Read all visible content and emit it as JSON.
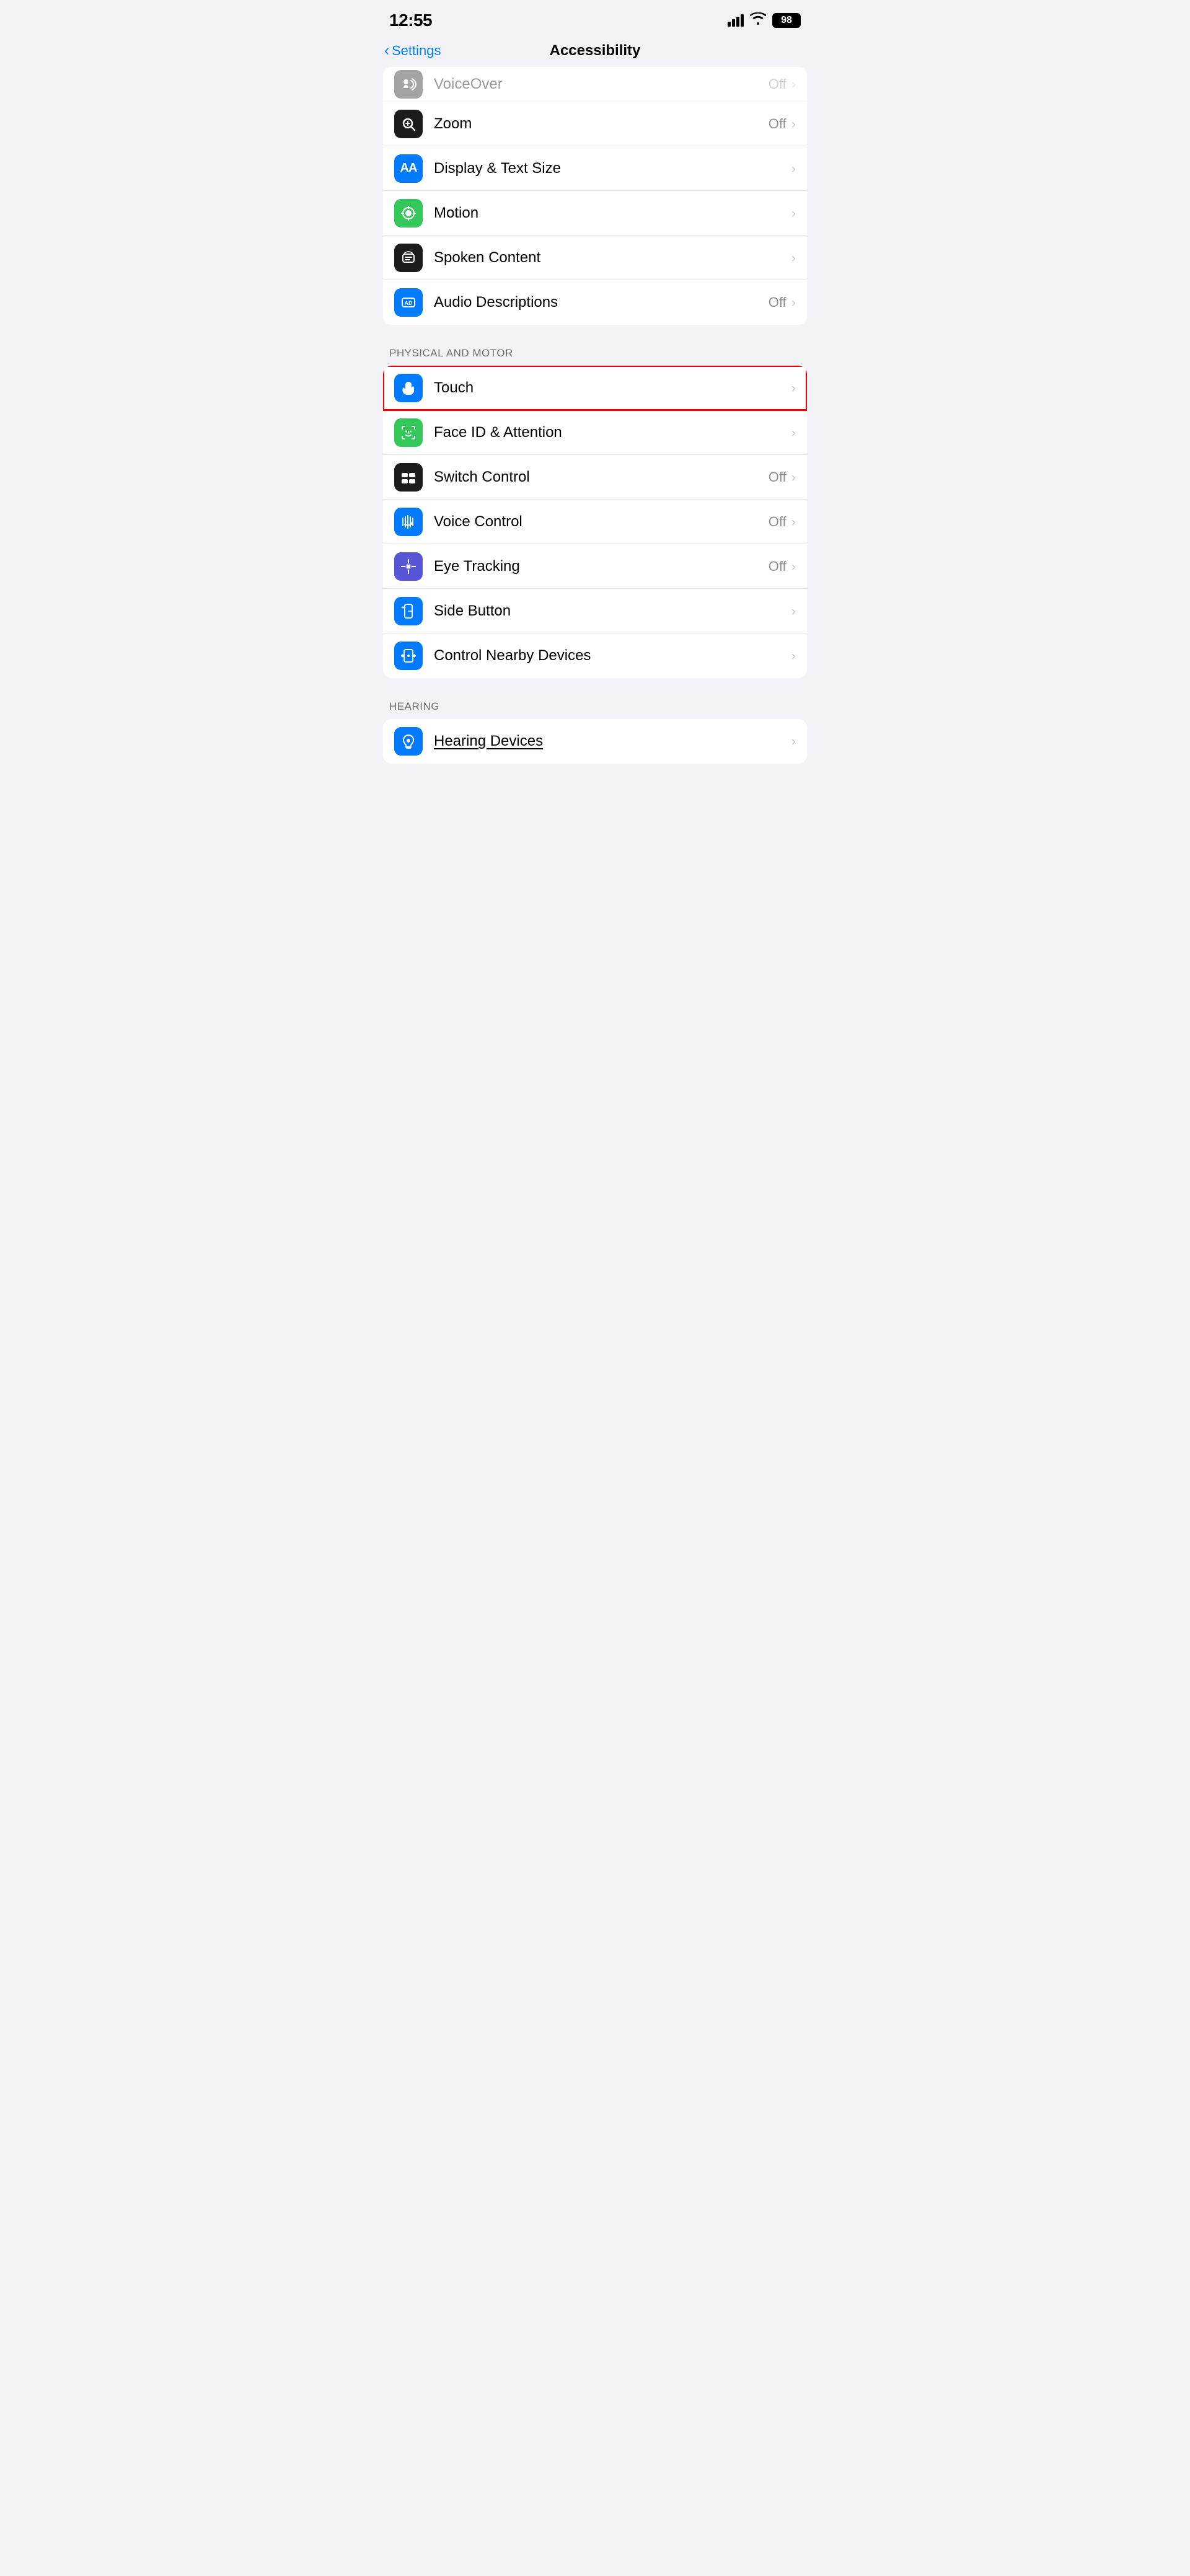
{
  "statusBar": {
    "time": "12:55",
    "battery": "98"
  },
  "navBar": {
    "backLabel": "Settings",
    "title": "Accessibility"
  },
  "visionSection": {
    "items": [
      {
        "id": "voiceover",
        "icon": "voiceover",
        "iconBg": "icon-black",
        "label": "VoiceOver",
        "value": "Off",
        "hasValue": true
      },
      {
        "id": "zoom",
        "icon": "zoom",
        "iconBg": "icon-black",
        "label": "Zoom",
        "value": "Off",
        "hasValue": true
      },
      {
        "id": "display-text-size",
        "icon": "aa",
        "iconBg": "icon-blue",
        "label": "Display & Text Size",
        "value": "",
        "hasValue": false
      },
      {
        "id": "motion",
        "icon": "motion",
        "iconBg": "icon-green",
        "label": "Motion",
        "value": "",
        "hasValue": false
      },
      {
        "id": "spoken-content",
        "icon": "spoken",
        "iconBg": "icon-black",
        "label": "Spoken Content",
        "value": "",
        "hasValue": false
      },
      {
        "id": "audio-descriptions",
        "icon": "audio-desc",
        "iconBg": "icon-blue",
        "label": "Audio Descriptions",
        "value": "Off",
        "hasValue": true
      }
    ]
  },
  "physicalMotorSection": {
    "header": "PHYSICAL AND MOTOR",
    "items": [
      {
        "id": "touch",
        "icon": "touch",
        "iconBg": "icon-blue",
        "label": "Touch",
        "value": "",
        "hasValue": false,
        "highlighted": true
      },
      {
        "id": "face-id",
        "icon": "face-id",
        "iconBg": "icon-green",
        "label": "Face ID & Attention",
        "value": "",
        "hasValue": false,
        "highlighted": false
      },
      {
        "id": "switch-control",
        "icon": "switch-control",
        "iconBg": "icon-black",
        "label": "Switch Control",
        "value": "Off",
        "hasValue": true,
        "highlighted": false
      },
      {
        "id": "voice-control",
        "icon": "voice-control",
        "iconBg": "icon-blue",
        "label": "Voice Control",
        "value": "Off",
        "hasValue": true,
        "highlighted": false
      },
      {
        "id": "eye-tracking",
        "icon": "eye-tracking",
        "iconBg": "icon-purple",
        "label": "Eye Tracking",
        "value": "Off",
        "hasValue": true,
        "highlighted": false
      },
      {
        "id": "side-button",
        "icon": "side-button",
        "iconBg": "icon-blue",
        "label": "Side Button",
        "value": "",
        "hasValue": false,
        "highlighted": false
      },
      {
        "id": "control-nearby",
        "icon": "control-nearby",
        "iconBg": "icon-blue",
        "label": "Control Nearby Devices",
        "value": "",
        "hasValue": false,
        "highlighted": false
      }
    ]
  },
  "hearingSection": {
    "header": "HEARING",
    "items": [
      {
        "id": "hearing-devices",
        "icon": "hearing",
        "iconBg": "icon-blue",
        "label": "Hearing Devices",
        "value": "",
        "hasValue": false,
        "underlined": true
      }
    ]
  }
}
